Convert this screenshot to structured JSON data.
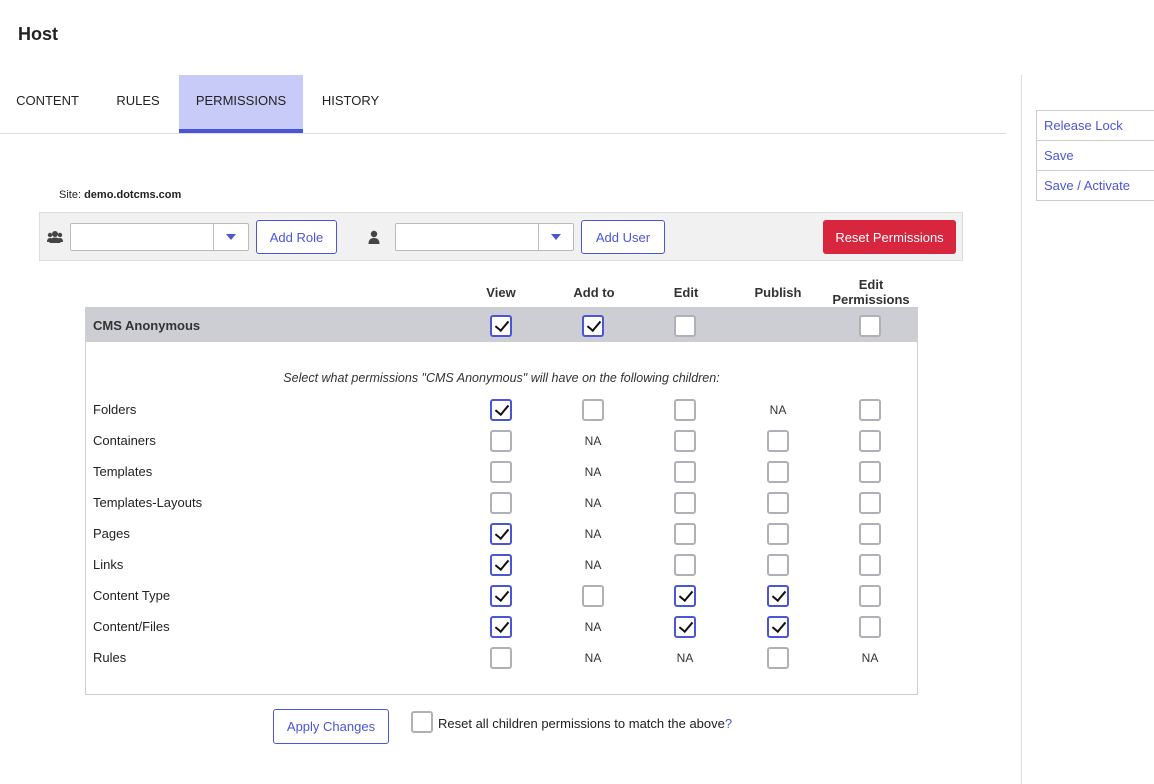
{
  "page": {
    "title": "Host"
  },
  "tabs": [
    {
      "label": "CONTENT",
      "active": false
    },
    {
      "label": "RULES",
      "active": false
    },
    {
      "label": "PERMISSIONS",
      "active": true
    },
    {
      "label": "HISTORY",
      "active": false
    }
  ],
  "side_actions": [
    "Release Lock",
    "Save",
    "Save / Activate"
  ],
  "site": {
    "label": "Site:",
    "value": "demo.dotcms.com"
  },
  "toolbar": {
    "role_icon": "users-icon",
    "role_input_value": "",
    "add_role_label": "Add Role",
    "user_icon": "user-icon",
    "user_input_value": "",
    "add_user_label": "Add User",
    "reset_label": "Reset Permissions"
  },
  "columns": [
    "View",
    "Add to",
    "Edit",
    "Publish",
    "Edit Permissions"
  ],
  "role": {
    "name": "CMS Anonymous",
    "permissions": [
      true,
      true,
      false,
      null,
      false
    ]
  },
  "children_note": "Select what permissions \"CMS Anonymous\" will have on the following children:",
  "na_text": "NA",
  "children": [
    {
      "label": "Folders",
      "values": [
        true,
        false,
        false,
        "NA",
        false
      ]
    },
    {
      "label": "Containers",
      "values": [
        false,
        "NA",
        false,
        false,
        false
      ]
    },
    {
      "label": "Templates",
      "values": [
        false,
        "NA",
        false,
        false,
        false
      ]
    },
    {
      "label": "Templates-Layouts",
      "values": [
        false,
        "NA",
        false,
        false,
        false
      ]
    },
    {
      "label": "Pages",
      "values": [
        true,
        "NA",
        false,
        false,
        false
      ]
    },
    {
      "label": "Links",
      "values": [
        true,
        "NA",
        false,
        false,
        false
      ]
    },
    {
      "label": "Content Type",
      "values": [
        true,
        false,
        true,
        true,
        false
      ]
    },
    {
      "label": "Content/Files",
      "values": [
        true,
        "NA",
        true,
        true,
        false
      ]
    },
    {
      "label": "Rules",
      "values": [
        false,
        "NA",
        "NA",
        false,
        "NA"
      ]
    }
  ],
  "footer": {
    "apply_label": "Apply Changes",
    "reset_children_label": "Reset all children permissions to match the above",
    "reset_children_help": "?",
    "reset_children_checked": false
  },
  "colors": {
    "accent": "#4b55d8",
    "danger": "#d7263d",
    "active_tab_bg": "#c8cbf7",
    "role_bar_bg": "#ccced3"
  }
}
